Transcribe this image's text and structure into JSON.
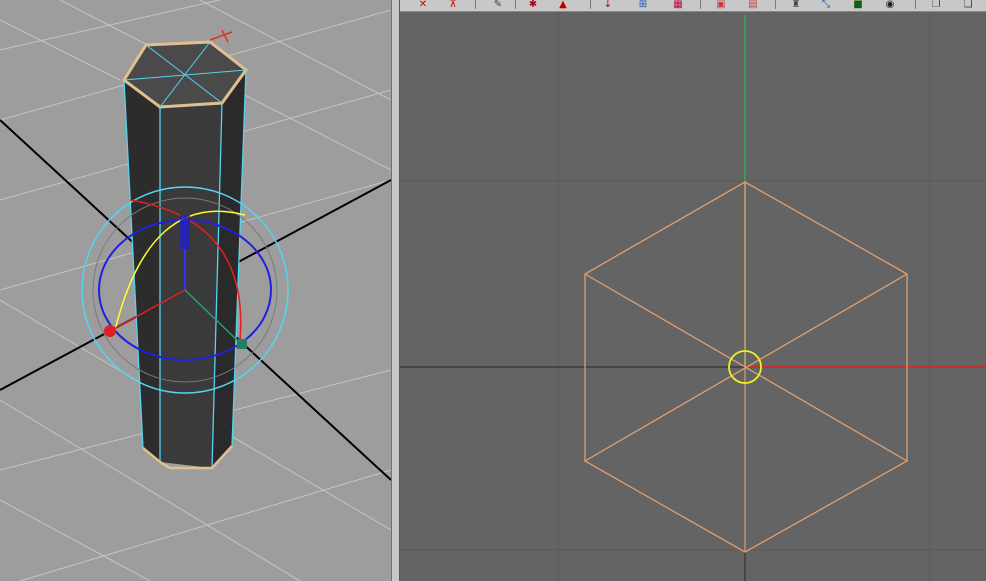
{
  "viewports": {
    "perspective": {
      "background": "#9d9d9d",
      "grid_color": "#c8c8c8",
      "axis_color": "#000000"
    },
    "top": {
      "background": "#646464",
      "grid_color": "#595959",
      "wire_color": "#e0a070"
    }
  },
  "object": {
    "type": "hexagonal-prism",
    "face_color": "#3c3c3c",
    "edge_highlight": "#56d3ef",
    "border_color": "#e0c090"
  },
  "manipulator": {
    "type": "rotate",
    "x_color": "#ff2020",
    "y_color": "#20a0ff",
    "z_color": "#2020e0",
    "view_ring": "#56d3ef"
  },
  "toolbar": {
    "icons": [
      "snap-curve-icon",
      "snap-point-icon",
      "paint-brush-icon",
      "isolate-icon",
      "select-camera-icon",
      "joint-icon",
      "grid-toggle-icon",
      "film-gate-icon",
      "resolution-gate-icon",
      "safe-action-icon",
      "hud-camera-icon",
      "xray-icon",
      "shaded-icon",
      "textured-icon",
      "light-icon",
      "panel-icon"
    ]
  },
  "colors": {
    "x_axis": "#ff0000",
    "y_axis": "#30c030",
    "pivot": "#ffff00"
  }
}
